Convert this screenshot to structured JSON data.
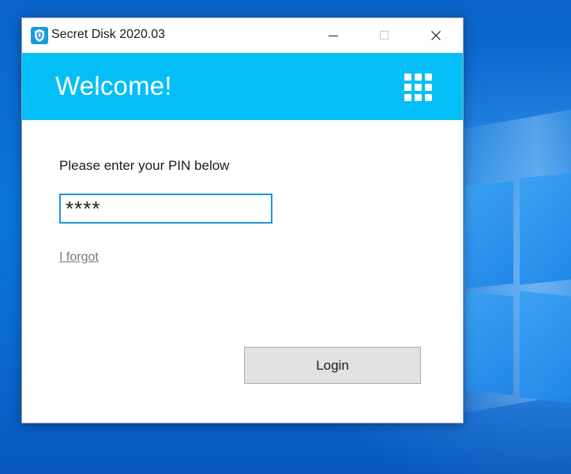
{
  "window": {
    "title": "Secret Disk 2020.03",
    "icon": "shield-icon"
  },
  "title_bar": {
    "minimize_icon": "minimize-icon",
    "maximize_icon": "maximize-icon",
    "close_icon": "close-icon"
  },
  "header": {
    "welcome_text": "Welcome!",
    "menu_icon": "grid-icon",
    "background_color": "#03bff5"
  },
  "form": {
    "prompt": "Please enter your PIN below",
    "pin_value": "****",
    "forgot_link": "I forgot",
    "login_label": "Login"
  },
  "colors": {
    "accent": "#03bff5",
    "input_border": "#1a97d6",
    "desktop": "#0a6fd6"
  }
}
